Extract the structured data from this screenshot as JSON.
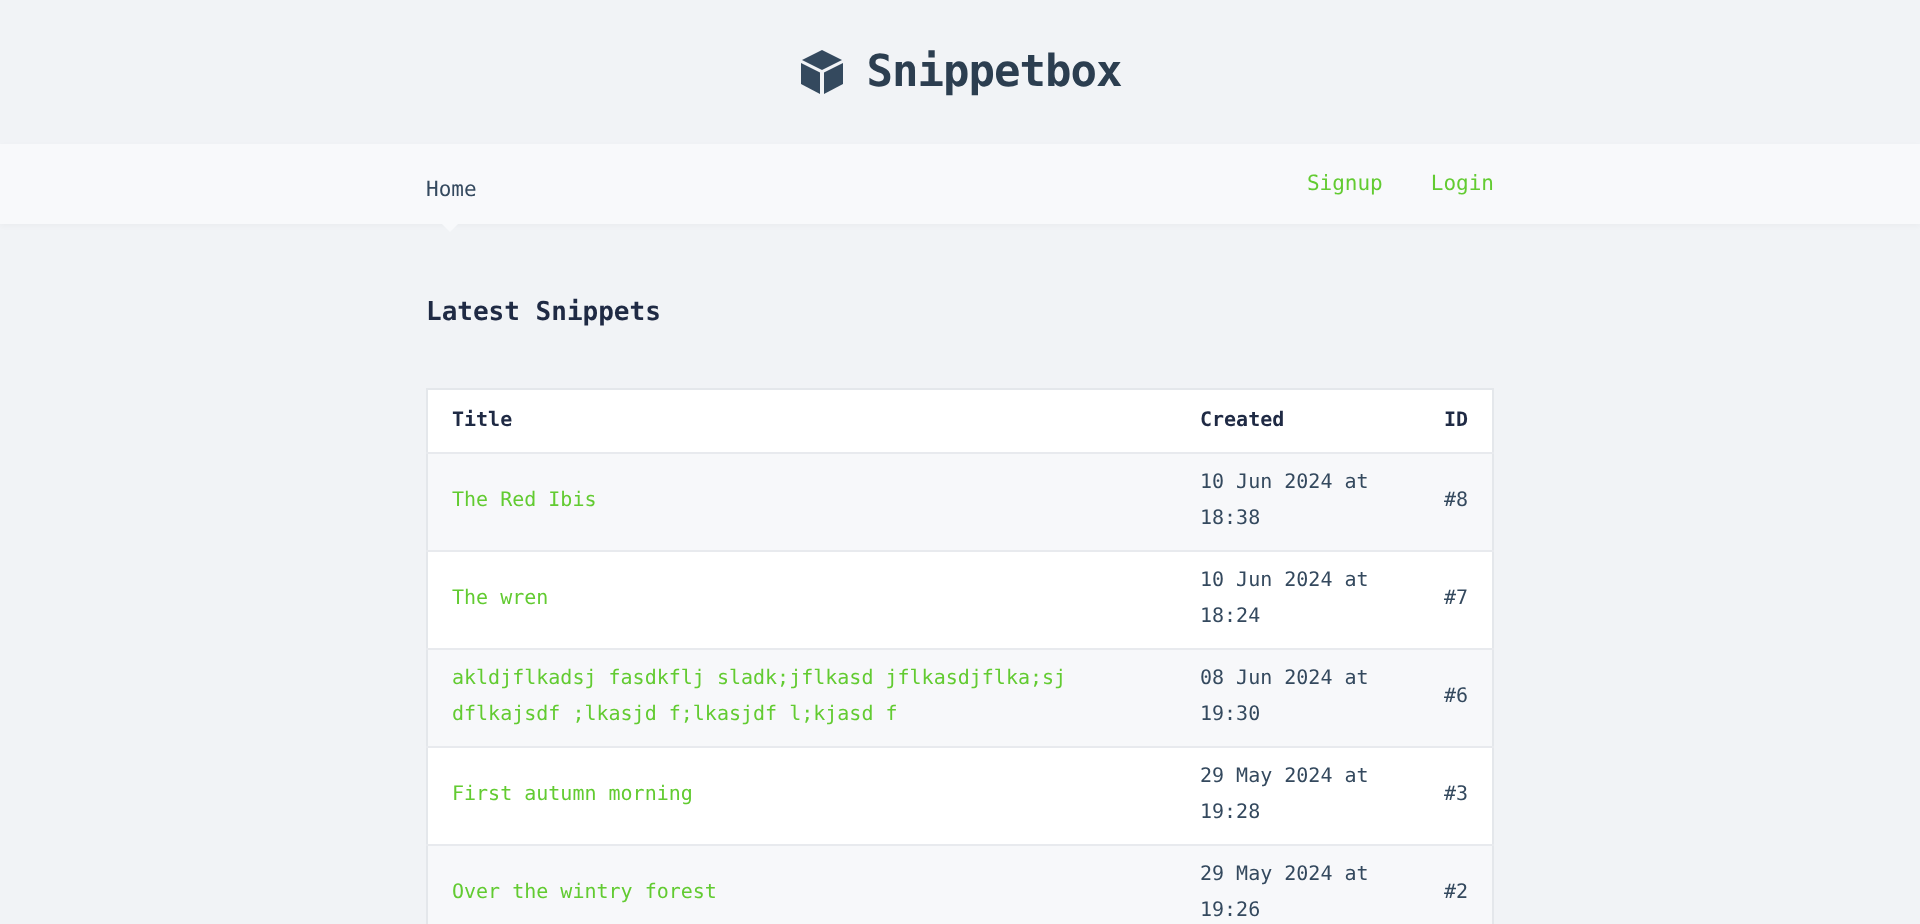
{
  "header": {
    "title": "Snippetbox"
  },
  "nav": {
    "left": [
      {
        "label": "Home",
        "selected": true
      }
    ],
    "right": [
      {
        "label": "Signup",
        "selected": false
      },
      {
        "label": "Login",
        "selected": false
      }
    ]
  },
  "heading": "Latest Snippets",
  "table": {
    "columns": [
      "Title",
      "Created",
      "ID"
    ],
    "rows": [
      {
        "title": "The Red Ibis",
        "created": "10 Jun 2024 at 18:38",
        "id": "#8"
      },
      {
        "title": "The wren",
        "created": "10 Jun 2024 at 18:24",
        "id": "#7"
      },
      {
        "title": "akldjflkadsj fasdkflj sladk;jflkasd jflkasdjflka;sj dflkajsdf ;lkasjd f;lkasjdf l;kjasd f",
        "created": "08 Jun 2024 at 19:30",
        "id": "#6"
      },
      {
        "title": "First autumn morning",
        "created": "29 May 2024 at 19:28",
        "id": "#3"
      },
      {
        "title": "Over the wintry forest",
        "created": "29 May 2024 at 19:26",
        "id": "#2"
      }
    ]
  }
}
